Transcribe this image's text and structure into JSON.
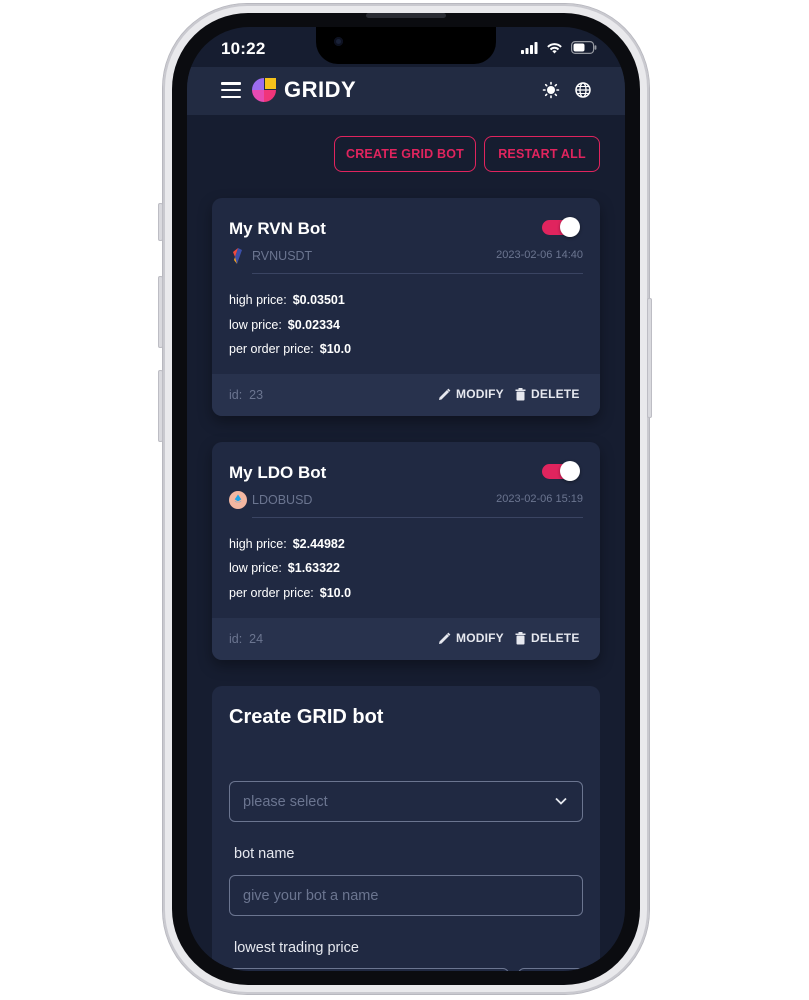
{
  "status_bar": {
    "time": "10:22"
  },
  "app": {
    "brand": "GRIDY"
  },
  "actions": {
    "create_grid_bot": "CREATE GRID BOT",
    "restart_all": "RESTART ALL"
  },
  "bots": [
    {
      "name": "My RVN Bot",
      "pair": "RVNUSDT",
      "date": "2023-02-06 14:40",
      "enabled": true,
      "high_label": "high price:",
      "high_value": "$0.03501",
      "low_label": "low price:",
      "low_value": "$0.02334",
      "per_order_label": "per order price:",
      "per_order_value": "$10.0",
      "id_label": "id:",
      "id_value": "23",
      "modify": "MODIFY",
      "delete": "DELETE"
    },
    {
      "name": "My LDO Bot",
      "pair": "LDOBUSD",
      "date": "2023-02-06 15:19",
      "enabled": true,
      "high_label": "high price:",
      "high_value": "$2.44982",
      "low_label": "low price:",
      "low_value": "$1.63322",
      "per_order_label": "per order price:",
      "per_order_value": "$10.0",
      "id_label": "id:",
      "id_value": "24",
      "modify": "MODIFY",
      "delete": "DELETE"
    }
  ],
  "create_form": {
    "title": "Create GRID bot",
    "select_placeholder": "please select",
    "bot_name_label": "bot name",
    "bot_name_placeholder": "give your bot a name",
    "lowest_price_label": "lowest trading price"
  },
  "colors": {
    "accent": "#e0245e",
    "background": "#161d30",
    "card": "#202942",
    "muted": "#6b7590"
  }
}
